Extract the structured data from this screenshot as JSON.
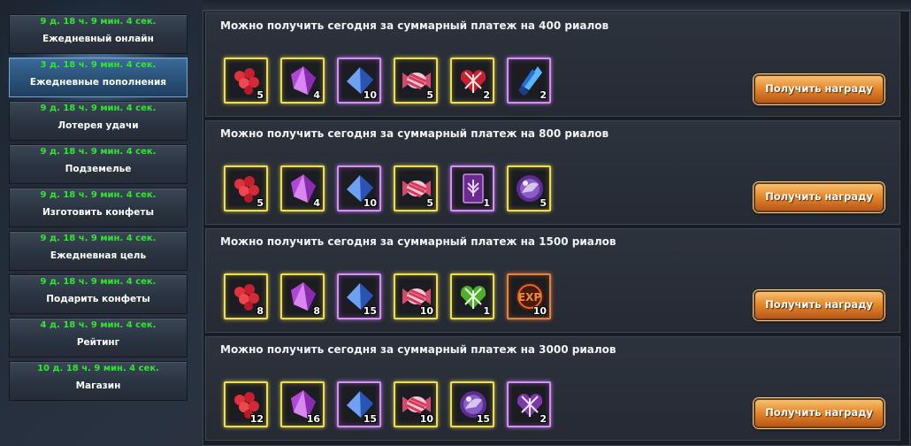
{
  "sidebar": {
    "items": [
      {
        "timer": "9 д. 18 ч. 9 мин. 4 сек.",
        "label": "Ежедневный онлайн"
      },
      {
        "timer": "3 д. 18 ч. 9 мин. 4 сек.",
        "label": "Ежедневные пополнения"
      },
      {
        "timer": "9 д. 18 ч. 9 мин. 4 сек.",
        "label": "Лотерея удачи"
      },
      {
        "timer": "9 д. 18 ч. 9 мин. 4 сек.",
        "label": "Подземелье"
      },
      {
        "timer": "9 д. 18 ч. 9 мин. 4 сек.",
        "label": "Изготовить конфеты"
      },
      {
        "timer": "9 д. 18 ч. 9 мин. 4 сек.",
        "label": "Ежедневная цель"
      },
      {
        "timer": "9 д. 18 ч. 9 мин. 4 сек.",
        "label": "Подарить конфеты"
      },
      {
        "timer": "4 д. 18 ч. 9 мин. 4 сек.",
        "label": "Рейтинг"
      },
      {
        "timer": "10 д. 18 ч. 9 мин. 4 сек.",
        "label": "Магазин"
      }
    ],
    "active_index": 1
  },
  "rewards": [
    {
      "title": "Можно получить сегодня за суммарный платеж на 400 риалов",
      "button": "Получить награду",
      "items": [
        {
          "icon": "red-candies-icon",
          "count": "5"
        },
        {
          "icon": "purple-crystal-icon",
          "count": "4"
        },
        {
          "icon": "blue-crystal-icon",
          "count": "10"
        },
        {
          "icon": "striped-candy-icon",
          "count": "5"
        },
        {
          "icon": "red-gift-box-icon",
          "count": "2"
        },
        {
          "icon": "blue-ice-shard-icon",
          "count": "2"
        }
      ]
    },
    {
      "title": "Можно получить сегодня за суммарный платеж на 800 риалов",
      "button": "Получить награду",
      "items": [
        {
          "icon": "red-candies-icon",
          "count": "5"
        },
        {
          "icon": "purple-crystal-icon",
          "count": "4"
        },
        {
          "icon": "blue-crystal-icon",
          "count": "10"
        },
        {
          "icon": "striped-candy-icon",
          "count": "5"
        },
        {
          "icon": "purple-scroll-icon",
          "count": "1"
        },
        {
          "icon": "purple-orb-icon",
          "count": "5"
        }
      ]
    },
    {
      "title": "Можно получить сегодня за суммарный платеж на 1500 риалов",
      "button": "Получить награду",
      "items": [
        {
          "icon": "red-candies-icon",
          "count": "8"
        },
        {
          "icon": "purple-crystal-icon",
          "count": "8"
        },
        {
          "icon": "blue-crystal-icon",
          "count": "15"
        },
        {
          "icon": "striped-candy-icon",
          "count": "10"
        },
        {
          "icon": "green-gift-box-icon",
          "count": "1"
        },
        {
          "icon": "exp-medal-icon",
          "count": "10"
        }
      ]
    },
    {
      "title": "Можно получить сегодня за суммарный платеж на 3000 риалов",
      "button": "Получить награду",
      "items": [
        {
          "icon": "red-candies-icon",
          "count": "12"
        },
        {
          "icon": "purple-crystal-icon",
          "count": "16"
        },
        {
          "icon": "blue-crystal-icon",
          "count": "15"
        },
        {
          "icon": "striped-candy-icon",
          "count": "10"
        },
        {
          "icon": "purple-orb-icon",
          "count": "15"
        },
        {
          "icon": "purple-gift-box-icon",
          "count": "2"
        }
      ]
    }
  ]
}
